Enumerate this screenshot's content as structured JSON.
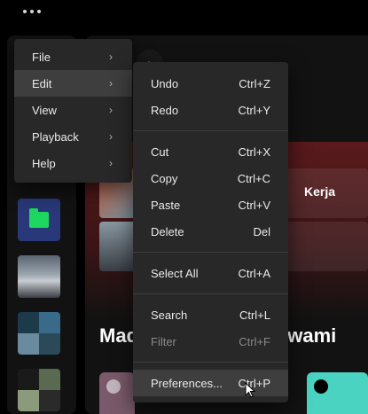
{
  "app": {
    "menu_dots_label": "More options"
  },
  "main": {
    "tile1_text": "Kerja",
    "section_title_left": "Mad",
    "section_title_right": "awami"
  },
  "menu": {
    "top_items": [
      {
        "label": "File"
      },
      {
        "label": "Edit"
      },
      {
        "label": "View"
      },
      {
        "label": "Playback"
      },
      {
        "label": "Help"
      }
    ],
    "edit_items": [
      {
        "label": "Undo",
        "shortcut": "Ctrl+Z"
      },
      {
        "label": "Redo",
        "shortcut": "Ctrl+Y"
      },
      {
        "label": "Cut",
        "shortcut": "Ctrl+X"
      },
      {
        "label": "Copy",
        "shortcut": "Ctrl+C"
      },
      {
        "label": "Paste",
        "shortcut": "Ctrl+V"
      },
      {
        "label": "Delete",
        "shortcut": "Del"
      },
      {
        "label": "Select All",
        "shortcut": "Ctrl+A"
      },
      {
        "label": "Search",
        "shortcut": "Ctrl+L"
      },
      {
        "label": "Filter",
        "shortcut": "Ctrl+F"
      },
      {
        "label": "Preferences...",
        "shortcut": "Ctrl+P"
      }
    ]
  }
}
